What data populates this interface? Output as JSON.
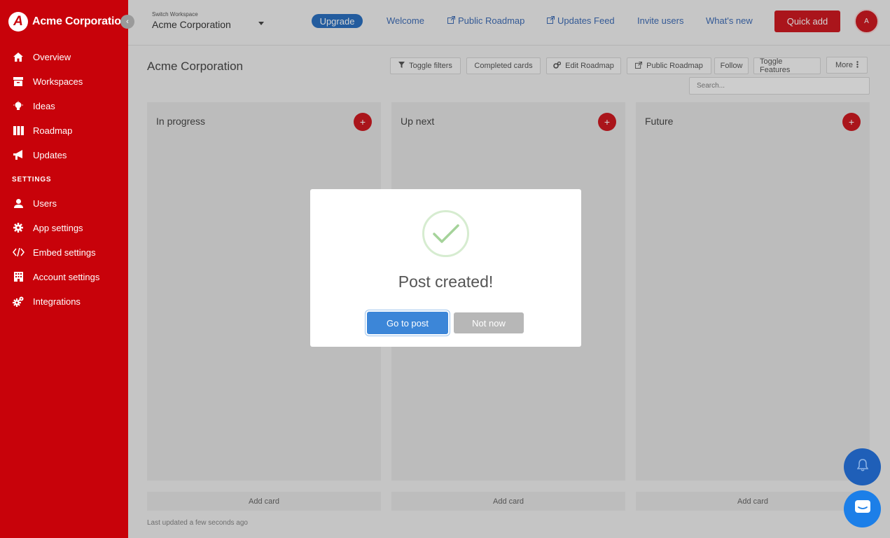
{
  "sidebar": {
    "brand_initial": "A",
    "brand_name": "Acme Corporation",
    "collapse_glyph": "‹",
    "items": [
      {
        "label": "Overview",
        "icon": "home-icon"
      },
      {
        "label": "Workspaces",
        "icon": "archive-icon"
      },
      {
        "label": "Ideas",
        "icon": "lightbulb-icon"
      },
      {
        "label": "Roadmap",
        "icon": "columns-icon"
      },
      {
        "label": "Updates",
        "icon": "megaphone-icon"
      }
    ],
    "settings_heading": "SETTINGS",
    "settings_items": [
      {
        "label": "Users",
        "icon": "user-icon"
      },
      {
        "label": "App settings",
        "icon": "gear-icon"
      },
      {
        "label": "Embed settings",
        "icon": "code-icon"
      },
      {
        "label": "Account settings",
        "icon": "building-icon"
      },
      {
        "label": "Integrations",
        "icon": "cogs-icon"
      }
    ]
  },
  "topbar": {
    "workspace_label": "Switch Workspace",
    "workspace_name": "Acme Corporation",
    "upgrade_label": "Upgrade",
    "links": [
      "Welcome",
      "Public Roadmap",
      "Updates Feed",
      "Invite users",
      "What's new"
    ],
    "quick_add_label": "Quick add",
    "avatar_initial": "A"
  },
  "main": {
    "title": "Acme Corporation",
    "toolbar": {
      "toggle_filters": "Toggle filters",
      "completed_cards": "Completed cards",
      "edit_roadmap": "Edit Roadmap",
      "public_roadmap": "Public Roadmap",
      "follow": "Follow",
      "toggle_features": "Toggle Features",
      "more": "More"
    },
    "search_placeholder": "Search...",
    "columns": [
      {
        "title": "In progress",
        "add_label": "Add card"
      },
      {
        "title": "Up next",
        "add_label": "Add card"
      },
      {
        "title": "Future",
        "add_label": "Add card"
      }
    ],
    "last_updated": "Last updated a few seconds ago"
  },
  "modal": {
    "title": "Post created!",
    "primary_label": "Go to post",
    "secondary_label": "Not now"
  },
  "colors": {
    "brand_red": "#c8020a",
    "link_blue": "#2a5dad",
    "upgrade_blue": "#1560b8",
    "success_green": "#a5d39a"
  }
}
